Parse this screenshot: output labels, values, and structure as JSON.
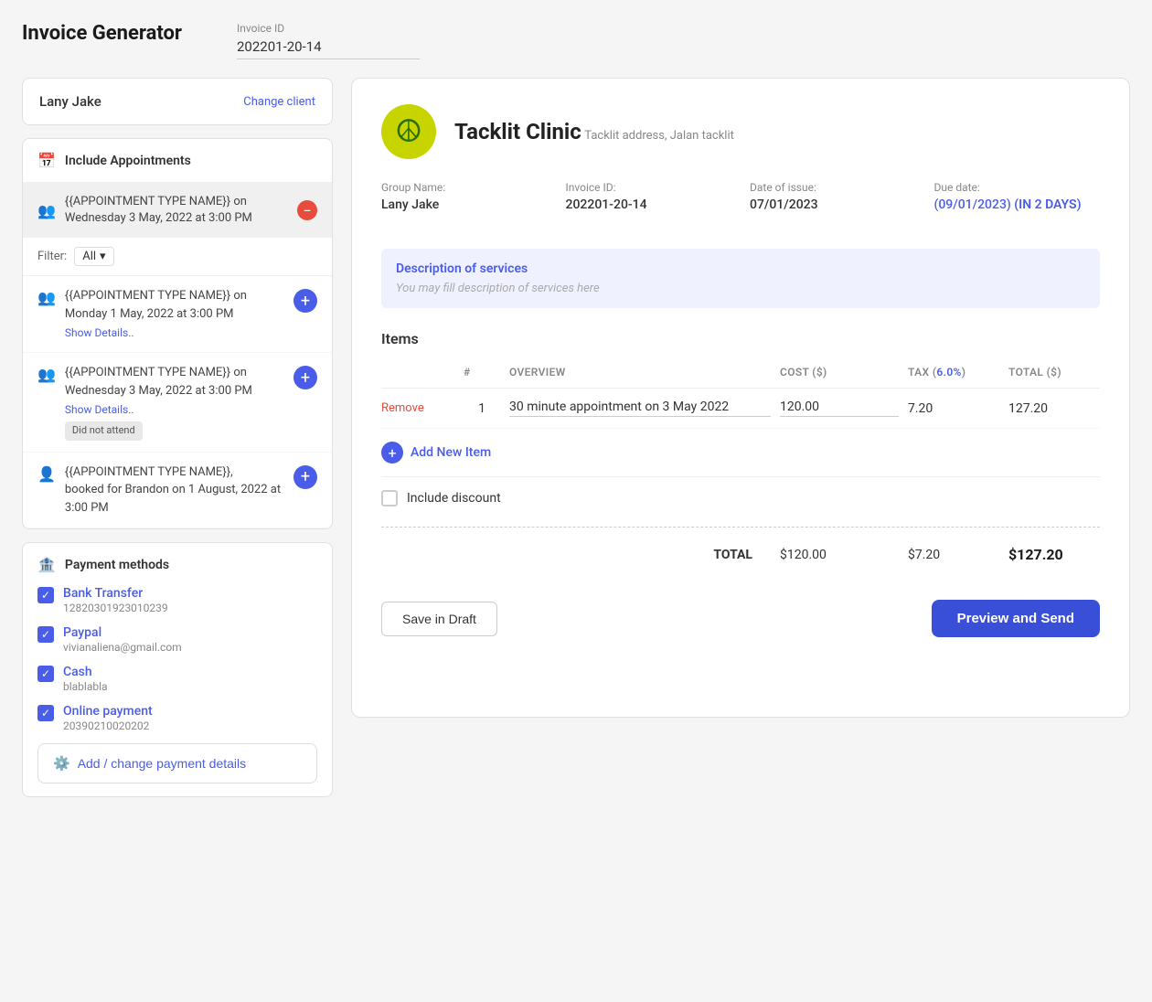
{
  "app": {
    "title": "Invoice Generator"
  },
  "invoice_id_section": {
    "label": "Invoice ID",
    "value": "202201-20-14"
  },
  "left": {
    "client": {
      "name": "Lany Jake",
      "change_label": "Change client"
    },
    "include_appointments": {
      "title": "Include Appointments",
      "selected_appointment": {
        "text_line1": "{{APPOINTMENT TYPE NAME}} on",
        "text_line2": "Wednesday 3 May, 2022 at 3:00 PM"
      },
      "filter": {
        "label": "Filter:",
        "value": "All"
      },
      "appointments": [
        {
          "text_line1": "{{APPOINTMENT TYPE NAME}} on",
          "text_line2": "Monday 1 May, 2022 at 3:00 PM",
          "show_details": "Show Details..",
          "badge": null
        },
        {
          "text_line1": "{{APPOINTMENT TYPE NAME}} on",
          "text_line2": "Wednesday 3 May, 2022 at 3:00 PM",
          "show_details": "Show Details..",
          "badge": "Did not attend"
        },
        {
          "text_line1": "{{APPOINTMENT TYPE NAME}},",
          "text_line2": "booked for Brandon on 1 August, 2022 at 3:00 PM",
          "show_details": null,
          "badge": null
        }
      ]
    },
    "payment_methods": {
      "title": "Payment methods",
      "methods": [
        {
          "name": "Bank Transfer",
          "detail": "12820301923010239"
        },
        {
          "name": "Paypal",
          "detail": "vivianaliena@gmail.com"
        },
        {
          "name": "Cash",
          "detail": "blablabla"
        },
        {
          "name": "Online payment",
          "detail": "20390210020202"
        }
      ],
      "add_button": "Add / change payment details"
    }
  },
  "invoice": {
    "clinic": {
      "name": "Tacklit Clinic",
      "address": "Tacklit address, Jalan tacklit"
    },
    "meta": {
      "group_name_label": "Group Name:",
      "group_name_value": "Lany Jake",
      "invoice_id_label": "Invoice ID:",
      "invoice_id_value": "202201-20-14",
      "date_of_issue_label": "Date of issue:",
      "date_of_issue_value": "07/01/2023",
      "due_date_label": "Due date:",
      "due_date_link": "(09/01/2023)",
      "due_date_suffix": " (IN 2 DAYS)"
    },
    "description": {
      "title": "Description of services",
      "placeholder": "You may fill description of services here"
    },
    "items": {
      "title": "Items",
      "columns": {
        "col0": "",
        "col1": "#",
        "col2": "OVERVIEW",
        "col3": "COST ($)",
        "col4": "TAX (6.0%)",
        "col5": "TOTAL ($)"
      },
      "rows": [
        {
          "remove": "Remove",
          "number": "1",
          "overview": "30 minute appointment on 3 May 2022",
          "cost": "120.00",
          "tax": "7.20",
          "total": "127.20"
        }
      ],
      "add_new_item": "Add New Item",
      "include_discount": "Include discount"
    },
    "totals": {
      "label": "TOTAL",
      "subtotal": "$120.00",
      "tax": "$7.20",
      "grand_total": "$127.20"
    },
    "actions": {
      "save_draft": "Save in Draft",
      "preview_send": "Preview and Send"
    }
  }
}
